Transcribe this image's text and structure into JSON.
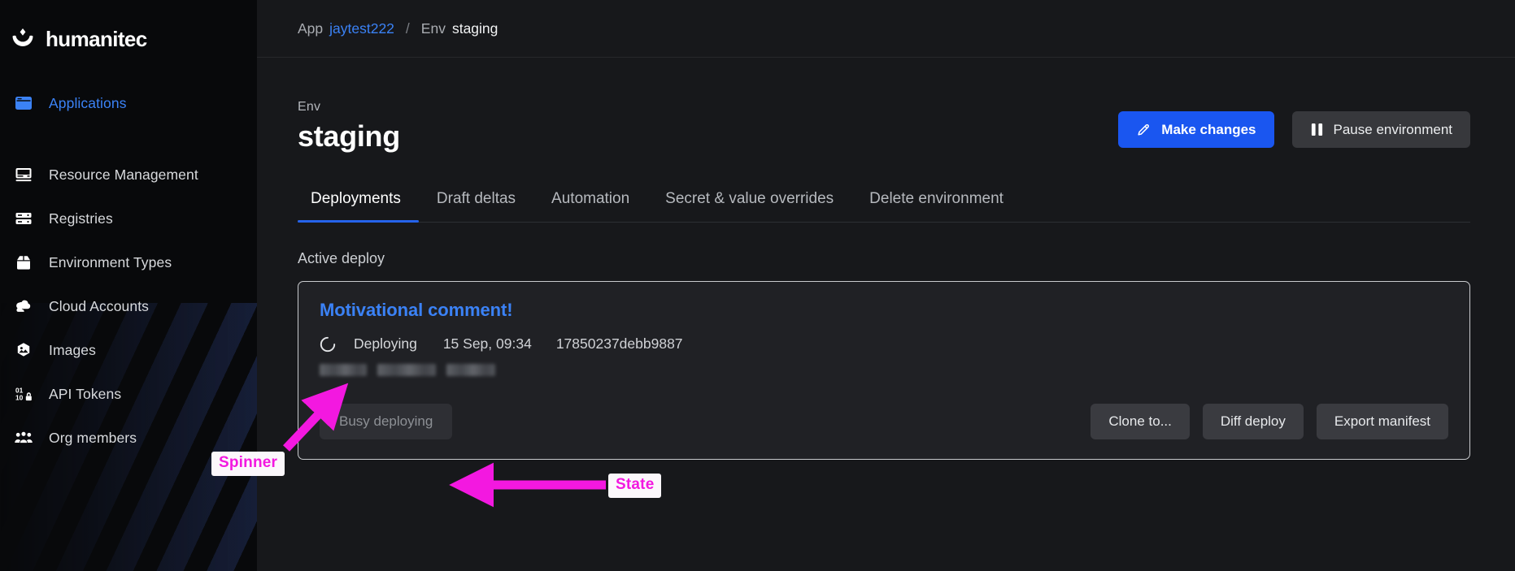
{
  "brand": {
    "name": "humanitec",
    "logo_icon": "humanitec-smile-logo"
  },
  "sidebar": {
    "items": [
      {
        "label": "Applications",
        "icon": "window-icon",
        "active": true
      },
      {
        "label": "Resource Management",
        "icon": "server-screen-icon",
        "active": false
      },
      {
        "label": "Registries",
        "icon": "server-rack-icon",
        "active": false
      },
      {
        "label": "Environment Types",
        "icon": "box-open-icon",
        "active": false
      },
      {
        "label": "Cloud Accounts",
        "icon": "cloud-icon",
        "active": false
      },
      {
        "label": "Images",
        "icon": "image-hexagon-icon",
        "active": false
      },
      {
        "label": "API Tokens",
        "icon": "binary-lock-icon",
        "active": false
      },
      {
        "label": "Org members",
        "icon": "people-group-icon",
        "active": false
      }
    ]
  },
  "breadcrumb": {
    "app_label": "App",
    "app_name": "jaytest222",
    "separator": "/",
    "env_label": "Env",
    "env_name": "staging"
  },
  "header": {
    "eyebrow": "Env",
    "title": "staging",
    "make_changes_label": "Make changes",
    "make_changes_icon": "pencil-icon",
    "pause_label": "Pause environment",
    "pause_icon": "pause-icon",
    "primary_color": "#1a56f0"
  },
  "tabs": [
    {
      "label": "Deployments",
      "active": true
    },
    {
      "label": "Draft deltas",
      "active": false
    },
    {
      "label": "Automation",
      "active": false
    },
    {
      "label": "Secret & value overrides",
      "active": false
    },
    {
      "label": "Delete environment",
      "active": false
    }
  ],
  "active_deploy": {
    "section_label": "Active deploy",
    "comment": "Motivational comment!",
    "status": "Deploying",
    "status_icon": "spinner-icon",
    "date": "15 Sep, 09:34",
    "hash": "17850237debb9887",
    "redacted_note": "redacted-text-blocks",
    "state_button": "Busy deploying",
    "actions": [
      {
        "label": "Clone to..."
      },
      {
        "label": "Diff deploy"
      },
      {
        "label": "Export manifest"
      }
    ]
  },
  "annotations": {
    "color": "#f318e0",
    "spinner_label": "Spinner",
    "state_label": "State"
  }
}
